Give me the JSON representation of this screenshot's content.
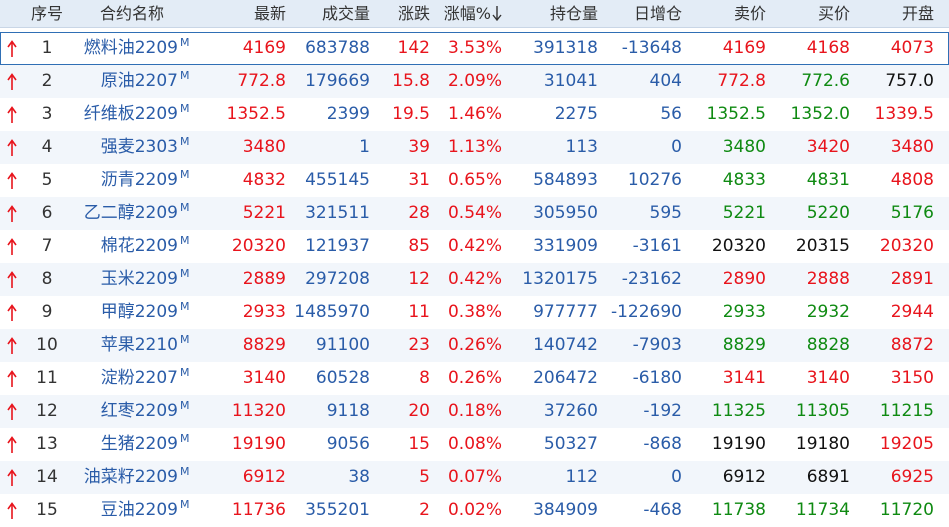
{
  "colors": {
    "up": "#e8141c",
    "down": "#0f8a12",
    "flat": "#111111",
    "neutral": "#2a5ca8"
  },
  "header": {
    "idx": "序号",
    "name": "合约名称",
    "last": "最新",
    "volume": "成交量",
    "change": "涨跌",
    "pct": "涨幅%",
    "sort_icon": "down-arrow-icon",
    "oi": "持仓量",
    "daily_oi": "日增仓",
    "ask": "卖价",
    "bid": "买价",
    "open": "开盘"
  },
  "rows": [
    {
      "idx": "1",
      "name": "燃料油2209",
      "mark": "M",
      "last": "4169",
      "volume": "683788",
      "change": "142",
      "pct": "3.53%",
      "oi": "391318",
      "daily_oi": "-13648",
      "ask": "4169",
      "bid": "4168",
      "open": "4073",
      "ask_color": "red",
      "bid_color": "red",
      "open_color": "red"
    },
    {
      "idx": "2",
      "name": "原油2207",
      "mark": "M",
      "last": "772.8",
      "volume": "179669",
      "change": "15.8",
      "pct": "2.09%",
      "oi": "31041",
      "daily_oi": "404",
      "ask": "772.8",
      "bid": "772.6",
      "open": "757.0",
      "ask_color": "red",
      "bid_color": "green",
      "open_color": "black"
    },
    {
      "idx": "3",
      "name": "纤维板2209",
      "mark": "M",
      "last": "1352.5",
      "volume": "2399",
      "change": "19.5",
      "pct": "1.46%",
      "oi": "2275",
      "daily_oi": "56",
      "ask": "1352.5",
      "bid": "1352.0",
      "open": "1339.5",
      "ask_color": "green",
      "bid_color": "green",
      "open_color": "red"
    },
    {
      "idx": "4",
      "name": "强麦2303",
      "mark": "M",
      "last": "3480",
      "volume": "1",
      "change": "39",
      "pct": "1.13%",
      "oi": "113",
      "daily_oi": "0",
      "ask": "3480",
      "bid": "3420",
      "open": "3480",
      "ask_color": "green",
      "bid_color": "red",
      "open_color": "red"
    },
    {
      "idx": "5",
      "name": "沥青2209",
      "mark": "M",
      "last": "4832",
      "volume": "455145",
      "change": "31",
      "pct": "0.65%",
      "oi": "584893",
      "daily_oi": "10276",
      "ask": "4833",
      "bid": "4831",
      "open": "4808",
      "ask_color": "green",
      "bid_color": "green",
      "open_color": "red"
    },
    {
      "idx": "6",
      "name": "乙二醇2209",
      "mark": "M",
      "last": "5221",
      "volume": "321511",
      "change": "28",
      "pct": "0.54%",
      "oi": "305950",
      "daily_oi": "595",
      "ask": "5221",
      "bid": "5220",
      "open": "5176",
      "ask_color": "green",
      "bid_color": "green",
      "open_color": "green"
    },
    {
      "idx": "7",
      "name": "棉花2209",
      "mark": "M",
      "last": "20320",
      "volume": "121937",
      "change": "85",
      "pct": "0.42%",
      "oi": "331909",
      "daily_oi": "-3161",
      "ask": "20320",
      "bid": "20315",
      "open": "20320",
      "ask_color": "black",
      "bid_color": "black",
      "open_color": "red"
    },
    {
      "idx": "8",
      "name": "玉米2209",
      "mark": "M",
      "last": "2889",
      "volume": "297208",
      "change": "12",
      "pct": "0.42%",
      "oi": "1320175",
      "daily_oi": "-23162",
      "ask": "2890",
      "bid": "2888",
      "open": "2891",
      "ask_color": "red",
      "bid_color": "red",
      "open_color": "red"
    },
    {
      "idx": "9",
      "name": "甲醇2209",
      "mark": "M",
      "last": "2933",
      "volume": "1485970",
      "change": "11",
      "pct": "0.38%",
      "oi": "977777",
      "daily_oi": "-122690",
      "ask": "2933",
      "bid": "2932",
      "open": "2944",
      "ask_color": "green",
      "bid_color": "green",
      "open_color": "red"
    },
    {
      "idx": "10",
      "name": "苹果2210",
      "mark": "M",
      "last": "8829",
      "volume": "91100",
      "change": "23",
      "pct": "0.26%",
      "oi": "140742",
      "daily_oi": "-7903",
      "ask": "8829",
      "bid": "8828",
      "open": "8872",
      "ask_color": "green",
      "bid_color": "green",
      "open_color": "red"
    },
    {
      "idx": "11",
      "name": "淀粉2207",
      "mark": "M",
      "last": "3140",
      "volume": "60528",
      "change": "8",
      "pct": "0.26%",
      "oi": "206472",
      "daily_oi": "-6180",
      "ask": "3141",
      "bid": "3140",
      "open": "3150",
      "ask_color": "red",
      "bid_color": "red",
      "open_color": "red"
    },
    {
      "idx": "12",
      "name": "红枣2209",
      "mark": "M",
      "last": "11320",
      "volume": "9118",
      "change": "20",
      "pct": "0.18%",
      "oi": "37260",
      "daily_oi": "-192",
      "ask": "11325",
      "bid": "11305",
      "open": "11215",
      "ask_color": "green",
      "bid_color": "green",
      "open_color": "green"
    },
    {
      "idx": "13",
      "name": "生猪2209",
      "mark": "M",
      "last": "19190",
      "volume": "9056",
      "change": "15",
      "pct": "0.08%",
      "oi": "50327",
      "daily_oi": "-868",
      "ask": "19190",
      "bid": "19180",
      "open": "19205",
      "ask_color": "black",
      "bid_color": "black",
      "open_color": "red"
    },
    {
      "idx": "14",
      "name": "油菜籽2209",
      "mark": "M",
      "last": "6912",
      "volume": "38",
      "change": "5",
      "pct": "0.07%",
      "oi": "112",
      "daily_oi": "0",
      "ask": "6912",
      "bid": "6891",
      "open": "6925",
      "ask_color": "black",
      "bid_color": "black",
      "open_color": "red"
    },
    {
      "idx": "15",
      "name": "豆油2209",
      "mark": "M",
      "last": "11736",
      "volume": "355201",
      "change": "2",
      "pct": "0.02%",
      "oi": "384909",
      "daily_oi": "-468",
      "ask": "11738",
      "bid": "11734",
      "open": "11720",
      "ask_color": "green",
      "bid_color": "green",
      "open_color": "green"
    }
  ]
}
